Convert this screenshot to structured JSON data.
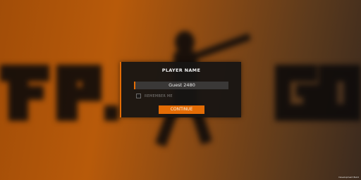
{
  "background": {
    "logo_text": "FPS GO",
    "colors": {
      "orange": "#b85a0a",
      "dark": "#3b2a1e"
    }
  },
  "dialog": {
    "title": "PLAYER NAME",
    "name_value": "Guest 2480",
    "remember_label": "REMEMBER ME",
    "remember_checked": false,
    "continue_label": "CONTINUE",
    "accent": "#e46c05"
  },
  "footer": {
    "build_label": "Development Build"
  }
}
